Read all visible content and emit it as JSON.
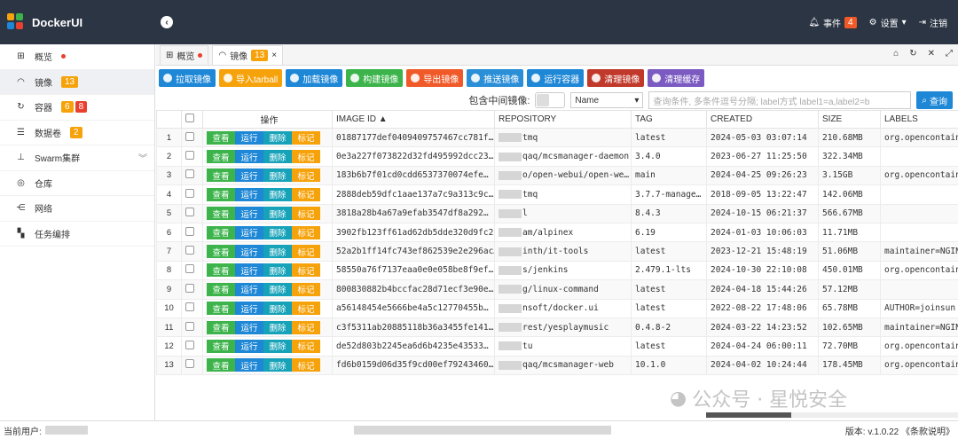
{
  "app": {
    "name": "DockerUI"
  },
  "header": {
    "events_label": "事件",
    "events_count": "4",
    "settings_label": "设置",
    "logout_label": "注销"
  },
  "sidebar": {
    "items": [
      {
        "label": "概览"
      },
      {
        "label": "镜像",
        "badge": "13"
      },
      {
        "label": "容器",
        "badge1": "6",
        "badge2": "8"
      },
      {
        "label": "数据卷",
        "badge": "2"
      },
      {
        "label": "Swarm集群"
      },
      {
        "label": "仓库"
      },
      {
        "label": "网络"
      },
      {
        "label": "任务编排"
      }
    ]
  },
  "tabs": [
    {
      "label": "概览"
    },
    {
      "label": "镜像",
      "badge": "13",
      "close": "×"
    }
  ],
  "toolbar": {
    "buttons": [
      "拉取镜像",
      "导入tarball",
      "加载镜像",
      "构建镜像",
      "导出镜像",
      "推送镜像",
      "运行容器",
      "清理镜像",
      "清理缓存"
    ]
  },
  "filter": {
    "include_label": "包含中间镜像:",
    "select_value": "Name",
    "placeholder": "查询条件, 多条件逗号分隔; label方式 label1=a,label2=b",
    "search_label": "查询"
  },
  "table": {
    "headers": [
      "",
      "",
      "操作",
      "IMAGE ID ▲",
      "REPOSITORY",
      "TAG",
      "CREATED",
      "SIZE",
      "LABELS"
    ],
    "action_labels": [
      "查看",
      "运行",
      "删除",
      "标记"
    ],
    "rows": [
      {
        "n": "1",
        "id": "01887177def0409409757467cc781f…",
        "repo": "tmq",
        "tag": "latest",
        "created": "2024-05-03 03:07:14",
        "size": "210.68MB",
        "labels": "org.opencontaine"
      },
      {
        "n": "2",
        "id": "0e3a227f073822d32fd495992dcc23…",
        "repo": "qaq/mcsmanager-daemon",
        "tag": "3.4.0",
        "created": "2023-06-27 11:25:50",
        "size": "322.34MB",
        "labels": ""
      },
      {
        "n": "3",
        "id": "183b6b7f01cd0cdd6537370074efe…",
        "repo": "o/open-webui/open-we…",
        "tag": "main",
        "created": "2024-04-25 09:26:23",
        "size": "3.15GB",
        "labels": "org.opencontaine"
      },
      {
        "n": "4",
        "id": "2888deb59dfc1aae137a7c9a313c9c…",
        "repo": "tmq",
        "tag": "3.7.7-manage…",
        "created": "2018-09-05 13:22:47",
        "size": "142.06MB",
        "labels": ""
      },
      {
        "n": "5",
        "id": "3818a28b4a67a9efab3547df8a292…",
        "repo": "l",
        "tag": "8.4.3",
        "created": "2024-10-15 06:21:37",
        "size": "566.67MB",
        "labels": ""
      },
      {
        "n": "6",
        "id": "3902fb123ff61ad62db5dde320d9fc23f…",
        "repo": "am/alpinex",
        "tag": "6.19",
        "created": "2024-01-03 10:06:03",
        "size": "11.71MB",
        "labels": ""
      },
      {
        "n": "7",
        "id": "52a2b1ff14fc743ef862539e2e296ac…",
        "repo": "inth/it-tools",
        "tag": "latest",
        "created": "2023-12-21 15:48:19",
        "size": "51.06MB",
        "labels": "maintainer=NGIN"
      },
      {
        "n": "8",
        "id": "58550a76f7137eaa0e0e058be8f9ef…",
        "repo": "s/jenkins",
        "tag": "2.479.1-lts",
        "created": "2024-10-30 22:10:08",
        "size": "450.01MB",
        "labels": "org.opencontaine"
      },
      {
        "n": "9",
        "id": "800830882b4bccfac28d71ecf3e90e…",
        "repo": "g/linux-command",
        "tag": "latest",
        "created": "2024-04-18 15:44:26",
        "size": "57.12MB",
        "labels": ""
      },
      {
        "n": "10",
        "id": "a56148454e5666be4a5c12770455b…",
        "repo": "nsoft/docker.ui",
        "tag": "latest",
        "created": "2022-08-22 17:48:06",
        "size": "65.78MB",
        "labels": "AUTHOR=joinsun"
      },
      {
        "n": "11",
        "id": "c3f5311ab20885118b36a3455fe141…",
        "repo": "rest/yesplaymusic",
        "tag": "0.4.8-2",
        "created": "2024-03-22 14:23:52",
        "size": "102.65MB",
        "labels": "maintainer=NGIN"
      },
      {
        "n": "12",
        "id": "de52d803b2245ea6d6b4235e43533…",
        "repo": "tu",
        "tag": "latest",
        "created": "2024-04-24 06:00:11",
        "size": "72.70MB",
        "labels": "org.opencontaine"
      },
      {
        "n": "13",
        "id": "fd6b0159d06d35f9cd00ef79243460…",
        "repo": "qaq/mcsmanager-web",
        "tag": "10.1.0",
        "created": "2024-04-02 10:24:44",
        "size": "178.45MB",
        "labels": "org.opencontaine"
      }
    ]
  },
  "footer": {
    "user_label": "当前用户:",
    "version_label": "版本: v.1.0.22 《条款说明》"
  },
  "watermark": {
    "text": "公众号 · 星悦安全"
  }
}
